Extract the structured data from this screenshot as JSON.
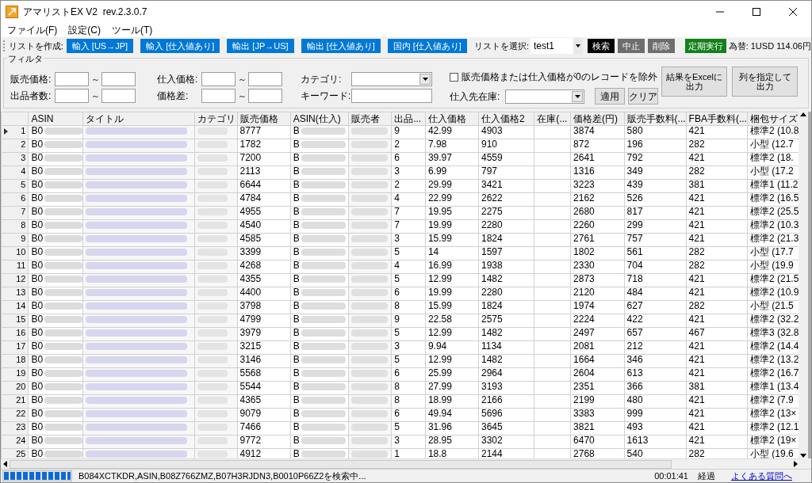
{
  "window": {
    "title": "アマリストEX V2  rev.2.3.0.7"
  },
  "menu": [
    "ファイル(F)",
    "設定(C)",
    "ツール(T)"
  ],
  "toolbar": {
    "create_label": "リストを作成:",
    "create_buttons": [
      {
        "label": "輸入 [US→JP]",
        "color": "#0078d7"
      },
      {
        "label": "輸入 [仕入値あり]",
        "color": "#0078d7"
      },
      {
        "label": "輸出 [JP→US]",
        "color": "#0078d7"
      },
      {
        "label": "輸出 [仕入値あり]",
        "color": "#0078d7"
      },
      {
        "label": "国内 [仕入値あり]",
        "color": "#0078d7"
      }
    ],
    "select_label": "リストを選択:",
    "list_select": {
      "value": "test1"
    },
    "action_buttons": [
      {
        "label": "検索",
        "color": "#000000"
      },
      {
        "label": "中止",
        "color": "#6d6d6d"
      },
      {
        "label": "削除",
        "color": "#6d6d6d"
      },
      {
        "label": "定期実行",
        "color": "#13801b"
      }
    ],
    "exchange_rate": "為替: 1USD 114.06円"
  },
  "filter": {
    "title": "フィルタ",
    "ranges": [
      {
        "label": "販売価格:",
        "separator": "～"
      },
      {
        "label": "出品者数:",
        "separator": "～"
      },
      {
        "label": "仕入価格:",
        "separator": "～"
      },
      {
        "label": "価格差:",
        "separator": "～"
      }
    ],
    "category_label": "カテゴリ:",
    "keyword_label": "キーワード:",
    "exclude_zero": {
      "label": "販売価格または仕入価格が0のレコードを除外",
      "checked": false
    },
    "stock_label": "仕入先在庫:",
    "apply": "適用",
    "clear": "クリア",
    "export_buttons": [
      "結果をExcelに出力",
      "列を指定して出力"
    ]
  },
  "table": {
    "columns": [
      "ASIN",
      "タイトル",
      "カテゴリ",
      "販売価格",
      "ASIN(仕入)",
      "販売者",
      "出品...",
      "仕入価格",
      "仕入価格2",
      "在庫(...",
      "価格差(円)",
      "販売手数料(...",
      "FBA手数料(...",
      "梱包サイズ"
    ],
    "rows": [
      {
        "selected": true,
        "number": "1",
        "asin": "B0",
        "sale_price": "8777",
        "source_asin": "B",
        "listings": "9",
        "cost": "42.99",
        "cost2": "4903",
        "price_diff": "3874",
        "sales_fee": "580",
        "fba_fee": "421",
        "package": "標準2 (10.8"
      },
      {
        "selected": false,
        "number": "2",
        "asin": "B0",
        "sale_price": "1782",
        "source_asin": "B",
        "listings": "2",
        "cost": "7.98",
        "cost2": "910",
        "price_diff": "872",
        "sales_fee": "196",
        "fba_fee": "282",
        "package": "小型 (12.7"
      },
      {
        "selected": false,
        "number": "3",
        "asin": "B0",
        "sale_price": "7200",
        "source_asin": "B",
        "listings": "6",
        "cost": "39.97",
        "cost2": "4559",
        "price_diff": "2641",
        "sales_fee": "792",
        "fba_fee": "421",
        "package": "標準2 (18."
      },
      {
        "selected": false,
        "number": "4",
        "asin": "B0",
        "sale_price": "2113",
        "source_asin": "B",
        "listings": "3",
        "cost": "6.99",
        "cost2": "797",
        "price_diff": "1316",
        "sales_fee": "349",
        "fba_fee": "282",
        "package": "小型 (17.2"
      },
      {
        "selected": false,
        "number": "5",
        "asin": "B0",
        "sale_price": "6644",
        "source_asin": "B",
        "listings": "2",
        "cost": "29.99",
        "cost2": "3421",
        "price_diff": "3223",
        "sales_fee": "439",
        "fba_fee": "381",
        "package": "標準1 (11.2"
      },
      {
        "selected": false,
        "number": "6",
        "asin": "B0",
        "sale_price": "4784",
        "source_asin": "B",
        "listings": "4",
        "cost": "22.99",
        "cost2": "2622",
        "price_diff": "2162",
        "sales_fee": "526",
        "fba_fee": "421",
        "package": "標準2 (16.5"
      },
      {
        "selected": false,
        "number": "7",
        "asin": "B0",
        "sale_price": "4955",
        "source_asin": "B",
        "listings": "7",
        "cost": "19.95",
        "cost2": "2275",
        "price_diff": "2680",
        "sales_fee": "817",
        "fba_fee": "421",
        "package": "標準2 (25.5"
      },
      {
        "selected": false,
        "number": "8",
        "asin": "B0",
        "sale_price": "4540",
        "source_asin": "B",
        "listings": "7",
        "cost": "19.99",
        "cost2": "2280",
        "price_diff": "2260",
        "sales_fee": "299",
        "fba_fee": "421",
        "package": "標準2 (10.3"
      },
      {
        "selected": false,
        "number": "9",
        "asin": "B0",
        "sale_price": "4585",
        "source_asin": "B",
        "listings": "3",
        "cost": "15.99",
        "cost2": "1824",
        "price_diff": "2761",
        "sales_fee": "757",
        "fba_fee": "421",
        "package": "標準2 (21.3"
      },
      {
        "selected": false,
        "number": "10",
        "asin": "B0",
        "sale_price": "3399",
        "source_asin": "B",
        "listings": "5",
        "cost": "14",
        "cost2": "1597",
        "price_diff": "1802",
        "sales_fee": "561",
        "fba_fee": "282",
        "package": "小型 (17.7"
      },
      {
        "selected": false,
        "number": "11",
        "asin": "B0",
        "sale_price": "4268",
        "source_asin": "B",
        "listings": "4",
        "cost": "16.99",
        "cost2": "1938",
        "price_diff": "2330",
        "sales_fee": "704",
        "fba_fee": "282",
        "package": "小型 (19.9"
      },
      {
        "selected": false,
        "number": "12",
        "asin": "B0",
        "sale_price": "4355",
        "source_asin": "B",
        "listings": "5",
        "cost": "12.99",
        "cost2": "1482",
        "price_diff": "2873",
        "sales_fee": "718",
        "fba_fee": "421",
        "package": "標準2 (21.5"
      },
      {
        "selected": false,
        "number": "13",
        "asin": "B0",
        "sale_price": "4400",
        "source_asin": "B",
        "listings": "6",
        "cost": "19.99",
        "cost2": "2280",
        "price_diff": "2120",
        "sales_fee": "484",
        "fba_fee": "421",
        "package": "標準2 (10.9"
      },
      {
        "selected": false,
        "number": "14",
        "asin": "B0",
        "sale_price": "3798",
        "source_asin": "B",
        "listings": "8",
        "cost": "15.99",
        "cost2": "1824",
        "price_diff": "1974",
        "sales_fee": "627",
        "fba_fee": "282",
        "package": "小型 (21.5"
      },
      {
        "selected": false,
        "number": "15",
        "asin": "B0",
        "sale_price": "4799",
        "source_asin": "B",
        "listings": "9",
        "cost": "22.58",
        "cost2": "2575",
        "price_diff": "2224",
        "sales_fee": "422",
        "fba_fee": "421",
        "package": "標準2 (32.2"
      },
      {
        "selected": false,
        "number": "16",
        "asin": "B0",
        "sale_price": "3979",
        "source_asin": "B",
        "listings": "5",
        "cost": "12.99",
        "cost2": "1482",
        "price_diff": "2497",
        "sales_fee": "657",
        "fba_fee": "467",
        "package": "標準3 (32.8"
      },
      {
        "selected": false,
        "number": "17",
        "asin": "B0",
        "sale_price": "3215",
        "source_asin": "B",
        "listings": "3",
        "cost": "9.94",
        "cost2": "1134",
        "price_diff": "2081",
        "sales_fee": "212",
        "fba_fee": "421",
        "package": "標準2 (14.4"
      },
      {
        "selected": false,
        "number": "18",
        "asin": "B0",
        "sale_price": "3146",
        "source_asin": "B",
        "listings": "5",
        "cost": "12.99",
        "cost2": "1482",
        "price_diff": "1664",
        "sales_fee": "346",
        "fba_fee": "421",
        "package": "標準2 (13.2"
      },
      {
        "selected": false,
        "number": "19",
        "asin": "B0",
        "sale_price": "5568",
        "source_asin": "B",
        "listings": "6",
        "cost": "25.99",
        "cost2": "2964",
        "price_diff": "2604",
        "sales_fee": "613",
        "fba_fee": "421",
        "package": "標準2 (16.7"
      },
      {
        "selected": false,
        "number": "20",
        "asin": "B0",
        "sale_price": "5544",
        "source_asin": "B",
        "listings": "8",
        "cost": "27.99",
        "cost2": "3193",
        "price_diff": "2351",
        "sales_fee": "366",
        "fba_fee": "381",
        "package": "標準1 (13.4"
      },
      {
        "selected": false,
        "number": "21",
        "asin": "B0",
        "sale_price": "4365",
        "source_asin": "B",
        "listings": "8",
        "cost": "18.99",
        "cost2": "2166",
        "price_diff": "2199",
        "sales_fee": "480",
        "fba_fee": "421",
        "package": "標準2 (7.9"
      },
      {
        "selected": false,
        "number": "22",
        "asin": "B0",
        "sale_price": "9079",
        "source_asin": "B",
        "listings": "6",
        "cost": "49.94",
        "cost2": "5696",
        "price_diff": "3383",
        "sales_fee": "999",
        "fba_fee": "421",
        "package": "標準2 (13×"
      },
      {
        "selected": false,
        "number": "23",
        "asin": "B0",
        "sale_price": "7466",
        "source_asin": "B",
        "listings": "5",
        "cost": "31.96",
        "cost2": "3645",
        "price_diff": "3821",
        "sales_fee": "493",
        "fba_fee": "421",
        "package": "標準2 (12.1"
      },
      {
        "selected": false,
        "number": "24",
        "asin": "B0",
        "sale_price": "9772",
        "source_asin": "B",
        "listings": "3",
        "cost": "28.95",
        "cost2": "3302",
        "price_diff": "6470",
        "sales_fee": "1613",
        "fba_fee": "421",
        "package": "標準2 (19×"
      },
      {
        "selected": false,
        "number": "25",
        "asin": "B0",
        "sale_price": "4912",
        "source_asin": "B",
        "listings": "1",
        "cost": "18.8",
        "cost2": "2144",
        "price_diff": "2768",
        "sales_fee": "540",
        "fba_fee": "282",
        "package": "小型 (19.6"
      }
    ]
  },
  "status_bar": {
    "progress": {
      "level": 1
    },
    "message": "B084XCTKDR,ASIN,B08Z766ZMZ,B07H3RJDN3,B0010P66Z2を検索中...",
    "elapsed": "00:01:41",
    "elapsed_label": "経過",
    "faq_link": "よくある質問へ"
  }
}
